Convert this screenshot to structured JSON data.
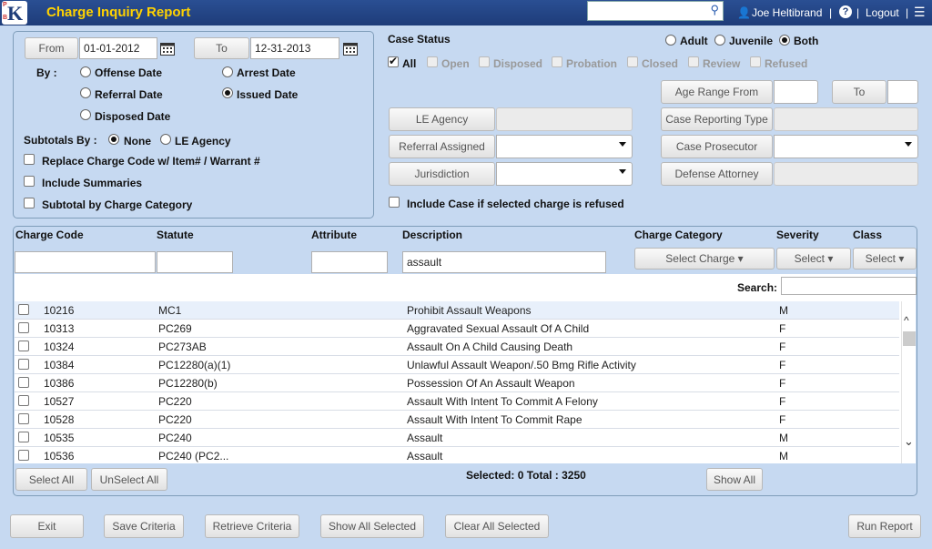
{
  "header": {
    "logo_letter": "K",
    "logo_p": "P",
    "logo_b": "B",
    "title": "Charge Inquiry Report",
    "search_icon": "search-icon",
    "user_name": "Joe Heltibrand",
    "sep": "|",
    "help_icon": "help-icon",
    "logout": "Logout",
    "menu_icon": "hamburger-icon"
  },
  "date_panel": {
    "from_label": "From",
    "from_value": "01-01-2012",
    "to_label": "To",
    "to_value": "12-31-2013",
    "by_label": "By :",
    "options": {
      "offense_date": "Offense Date",
      "arrest_date": "Arrest Date",
      "referral_date": "Referral Date",
      "issued_date": "Issued Date",
      "disposed_date": "Disposed Date"
    },
    "selected_by": "issued_date",
    "subtotals_label": "Subtotals By :",
    "subtotals_none": "None",
    "subtotals_le": "LE Agency",
    "replace_charge": "Replace Charge Code w/ Item# / Warrant #",
    "include_summaries": "Include Summaries",
    "subtotal_category": "Subtotal by Charge Category"
  },
  "case_status": {
    "label": "Case Status",
    "adult": "Adult",
    "juvenile": "Juvenile",
    "both": "Both",
    "all": "All",
    "open": "Open",
    "disposed": "Disposed",
    "probation": "Probation",
    "closed": "Closed",
    "review": "Review",
    "refused": "Refused"
  },
  "filters": {
    "age_range_from": "Age Range From",
    "age_to": "To",
    "le_agency": "LE Agency",
    "case_reporting_type": "Case Reporting Type",
    "referral_assigned": "Referral Assigned",
    "case_prosecutor": "Case Prosecutor",
    "jurisdiction": "Jurisdiction",
    "defense_attorney": "Defense Attorney",
    "include_refused": "Include Case if selected charge is refused"
  },
  "grid": {
    "columns": {
      "charge_code": "Charge Code",
      "statute": "Statute",
      "attribute": "Attribute",
      "description": "Description",
      "charge_category": "Charge Category",
      "severity": "Severity",
      "class": "Class"
    },
    "description_filter": "assault",
    "select_charge": "Select Charge",
    "select_severity": "Select",
    "select_class": "Select",
    "search_label": "Search:",
    "rows": [
      {
        "code": "10216",
        "statute": "MC1",
        "description": "Prohibit Assault Weapons",
        "severity": "M"
      },
      {
        "code": "10313",
        "statute": "PC269",
        "description": "Aggravated Sexual Assault Of A Child",
        "severity": "F"
      },
      {
        "code": "10324",
        "statute": "PC273AB",
        "description": "Assault On A Child Causing Death",
        "severity": "F"
      },
      {
        "code": "10384",
        "statute": "PC12280(a)(1)",
        "description": "Unlawful Assault Weapon/.50 Bmg Rifle Activity",
        "severity": "F"
      },
      {
        "code": "10386",
        "statute": "PC12280(b)",
        "description": "Possession Of An Assault Weapon",
        "severity": "F"
      },
      {
        "code": "10527",
        "statute": "PC220",
        "description": "Assault With Intent To Commit A Felony",
        "severity": "F"
      },
      {
        "code": "10528",
        "statute": "PC220",
        "description": "Assault With Intent To Commit Rape",
        "severity": "F"
      },
      {
        "code": "10535",
        "statute": "PC240",
        "description": "Assault",
        "severity": "M"
      },
      {
        "code": "10536",
        "statute": "PC240 (PC2...",
        "description": "Assault",
        "severity": "M"
      }
    ],
    "select_all": "Select All",
    "unselect_all": "UnSelect All",
    "selected_status": "Selected: 0 Total : 3250",
    "show_all": "Show All"
  },
  "footer": {
    "exit": "Exit",
    "save_criteria": "Save Criteria",
    "retrieve_criteria": "Retrieve Criteria",
    "show_all_selected": "Show All Selected",
    "clear_all_selected": "Clear All Selected",
    "run_report": "Run Report"
  }
}
